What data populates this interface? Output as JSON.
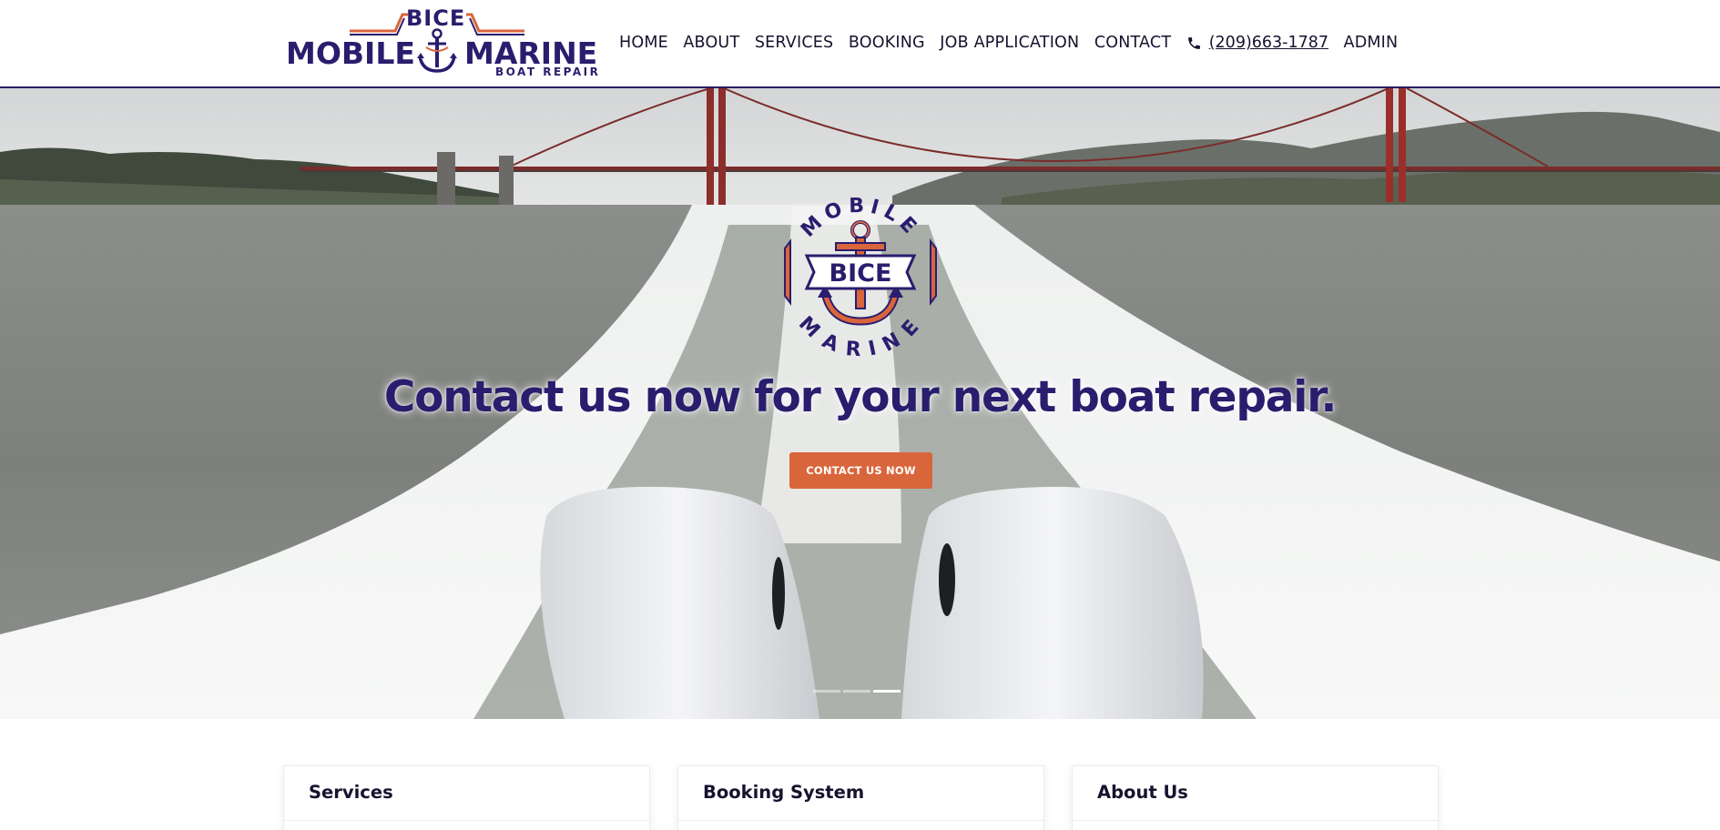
{
  "brand": {
    "logo_top": "BICE",
    "logo_left": "MOBILE",
    "logo_right": "MARINE",
    "logo_sub": "BOAT REPAIR",
    "emblem_top": "MOBILE",
    "emblem_center": "BICE",
    "emblem_bottom": "MARINE",
    "primary_color": "#2a1d6e",
    "accent_color": "#d9653b"
  },
  "nav": {
    "items": [
      {
        "label": "HOME"
      },
      {
        "label": "ABOUT"
      },
      {
        "label": "SERVICES"
      },
      {
        "label": "BOOKING"
      },
      {
        "label": "JOB APPLICATION"
      },
      {
        "label": "CONTACT"
      }
    ],
    "phone": {
      "icon": "phone-icon",
      "label": "(209)663-1787"
    },
    "admin": "ADMIN"
  },
  "hero": {
    "title": "Contact us now for your next boat repair.",
    "button": "CONTACT US NOW",
    "slides": 3,
    "active_slide": 3
  },
  "cards": [
    {
      "title": "Services"
    },
    {
      "title": "Booking System"
    },
    {
      "title": "About Us"
    }
  ]
}
